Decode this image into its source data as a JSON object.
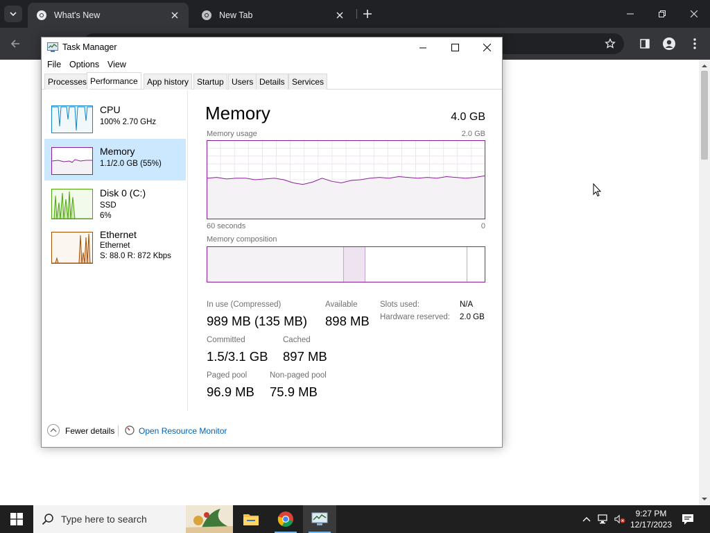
{
  "chrome": {
    "tabs": [
      {
        "title": "What's New",
        "active": true
      },
      {
        "title": "New Tab",
        "active": false
      }
    ]
  },
  "task_manager": {
    "title": "Task Manager",
    "menu": [
      "File",
      "Options",
      "View"
    ],
    "tabs": [
      "Processes",
      "Performance",
      "App history",
      "Startup",
      "Users",
      "Details",
      "Services"
    ],
    "active_tab": "Performance",
    "sidebar": [
      {
        "name": "CPU",
        "line1": "100%  2.70 GHz",
        "line2": "",
        "color": "#1185c6"
      },
      {
        "name": "Memory",
        "line1": "1.1/2.0 GB (55%)",
        "line2": "",
        "color": "#8b1f9b",
        "selected": true
      },
      {
        "name": "Disk 0 (C:)",
        "line1": "SSD",
        "line2": "6%",
        "color": "#4da60c"
      },
      {
        "name": "Ethernet",
        "line1": "Ethernet",
        "line2": "S: 88.0  R: 872 Kbps",
        "color": "#a74f01"
      }
    ],
    "memory": {
      "title": "Memory",
      "total": "4.0 GB",
      "usage_label": "Memory usage",
      "usage_max": "2.0 GB",
      "axis_left": "60 seconds",
      "axis_right": "0",
      "composition_label": "Memory composition",
      "composition_fractions": {
        "in_use": 0.49,
        "modified": 0.08,
        "standby": 0.365,
        "free": 0.065
      },
      "usage_series": [
        0.52,
        0.53,
        0.51,
        0.52,
        0.52,
        0.5,
        0.51,
        0.52,
        0.5,
        0.46,
        0.44,
        0.47,
        0.52,
        0.48,
        0.46,
        0.49,
        0.5,
        0.52,
        0.53,
        0.52,
        0.54,
        0.53,
        0.52,
        0.53,
        0.52,
        0.54,
        0.53,
        0.52,
        0.53,
        0.55
      ],
      "stats": {
        "in_use_label": "In use (Compressed)",
        "in_use_value": "989 MB (135 MB)",
        "available_label": "Available",
        "available_value": "898 MB",
        "slots_label": "Slots used:",
        "slots_value": "N/A",
        "hw_reserved_label": "Hardware reserved:",
        "hw_reserved_value": "2.0 GB",
        "committed_label": "Committed",
        "committed_value": "1.5/3.1 GB",
        "cached_label": "Cached",
        "cached_value": "897 MB",
        "paged_label": "Paged pool",
        "paged_value": "96.9 MB",
        "nonpaged_label": "Non-paged pool",
        "nonpaged_value": "75.9 MB"
      }
    },
    "footer": {
      "fewer_details": "Fewer details",
      "resource_monitor": "Open Resource Monitor"
    }
  },
  "taskbar": {
    "search_placeholder": "Type here to search",
    "time": "9:27 PM",
    "date": "12/17/2023"
  },
  "colors": {
    "memory_accent": "#8b1f9b",
    "memory_fill": "#f4f2f4",
    "selected_bg": "#cce8ff",
    "link": "#0063b1"
  }
}
